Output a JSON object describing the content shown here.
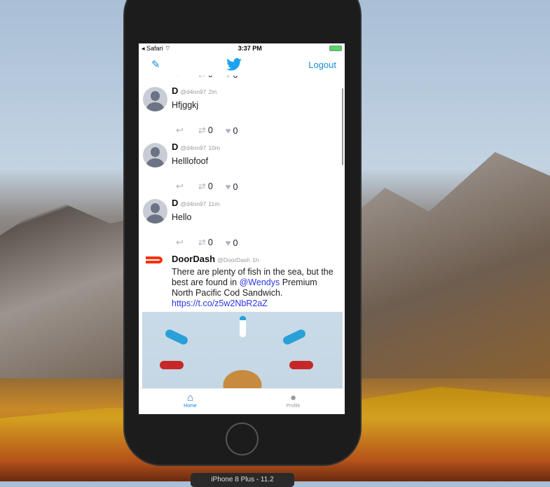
{
  "status": {
    "carrier": "Safari",
    "time": "3:37 PM"
  },
  "nav": {
    "logout": "Logout"
  },
  "tweets": [
    {
      "name": "D",
      "handle": "@d4nn97",
      "time": "2m",
      "text": "Hfjggkj",
      "retweets": "0",
      "likes": "0"
    },
    {
      "name": "D",
      "handle": "@d4nn97",
      "time": "10m",
      "text": "Helllofoof",
      "retweets": "0",
      "likes": "0"
    },
    {
      "name": "D",
      "handle": "@d4nn97",
      "time": "11m",
      "text": "Hello",
      "retweets": "0",
      "likes": "0"
    }
  ],
  "partial_tweet": {
    "retweets": "0",
    "likes": "0"
  },
  "doordash": {
    "name": "DoorDash",
    "handle": "@DoorDash",
    "time": "1h",
    "text1": "There are plenty of fish in the sea, but the best are found in ",
    "mention": "@Wendys",
    "text2": " Premium North Pacific Cod Sandwich. ",
    "link": "https://t.co/z5w2NbR2aZ"
  },
  "tabs": {
    "home": "Home",
    "profile": "Profile"
  },
  "simulator": {
    "label": "iPhone 8 Plus - 11.2"
  }
}
